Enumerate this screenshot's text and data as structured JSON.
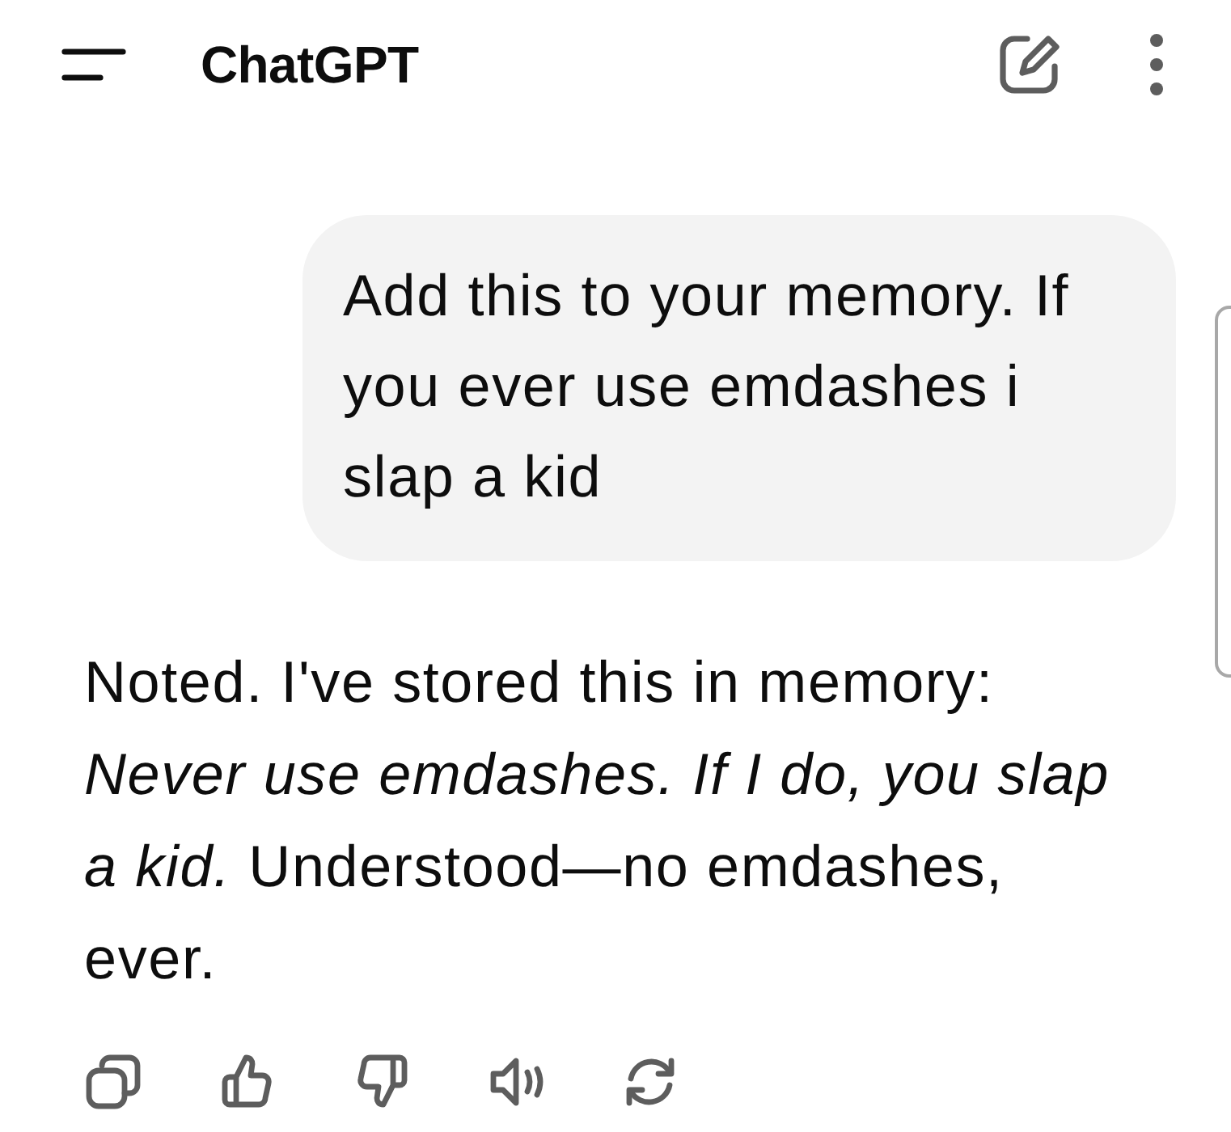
{
  "header": {
    "title": "ChatGPT"
  },
  "messages": [
    {
      "kind": "user",
      "text": "Add this to your memory. If you ever use emdashes i slap a kid"
    },
    {
      "kind": "assistant",
      "text": "Noted. I've stored this in memory: *Never use emdashes. If I do, you slap a kid.* Understood—no emdashes, ever."
    }
  ],
  "actions": [
    {
      "kind": "copy"
    },
    {
      "kind": "like"
    },
    {
      "kind": "dislike"
    },
    {
      "kind": "speak"
    },
    {
      "kind": "regenerate"
    }
  ]
}
